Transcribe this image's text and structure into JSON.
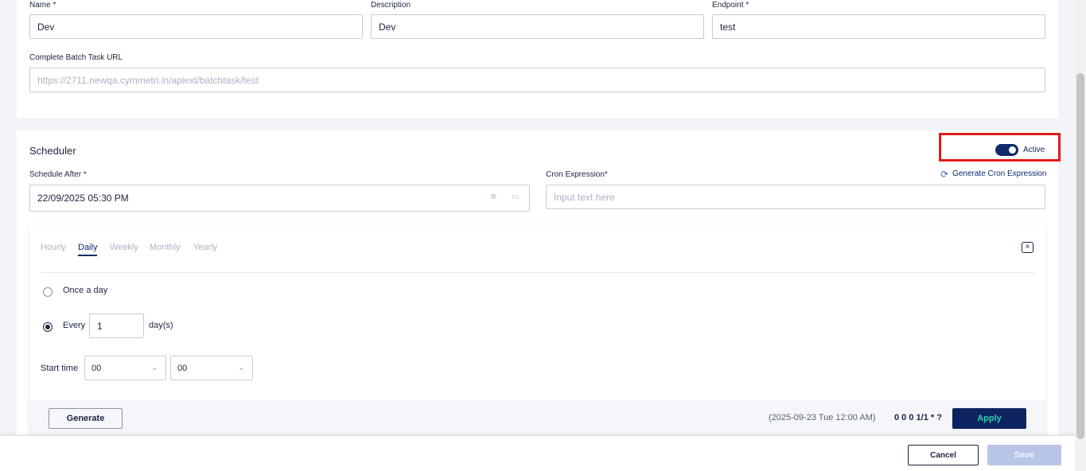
{
  "form": {
    "name_label": "Name *",
    "name_value": "Dev",
    "description_label": "Description",
    "description_value": "Dev",
    "endpoint_label": "Endpoint *",
    "endpoint_value": "test",
    "batch_url_label": "Complete Batch Task URL",
    "batch_url_placeholder": "https://2711.newqa.cymmetri.in/apiext/batchtask/test"
  },
  "scheduler": {
    "title": "Scheduler",
    "active_label": "Active",
    "active": true,
    "schedule_after_label": "Schedule After *",
    "schedule_after_value": "22/09/2025 05:30 PM",
    "cron_label": "Cron Expression*",
    "cron_placeholder": "Input text here",
    "generate_cron_label": "Generate Cron Expression"
  },
  "cron_builder": {
    "tabs": [
      "Hourly",
      "Daily",
      "Weekly",
      "Monthly",
      "Yearly"
    ],
    "active_tab": "Daily",
    "once_label": "Once a day",
    "every_label": "Every",
    "every_value": "1",
    "every_unit": "day(s)",
    "start_time_label": "Start time",
    "start_hour": "00",
    "start_minute": "00",
    "generate_label": "Generate",
    "next_run": "(2025-09-23 Tue 12:00 AM)",
    "cron_result": "0 0 0 1/1 * ?",
    "apply_label": "Apply"
  },
  "footer": {
    "cancel_label": "Cancel",
    "save_label": "Save"
  },
  "colors": {
    "primary": "#0e2a6a",
    "accent": "#2bd4a7",
    "highlight": "#e01b1b",
    "save_disabled": "#b9c5e6"
  }
}
